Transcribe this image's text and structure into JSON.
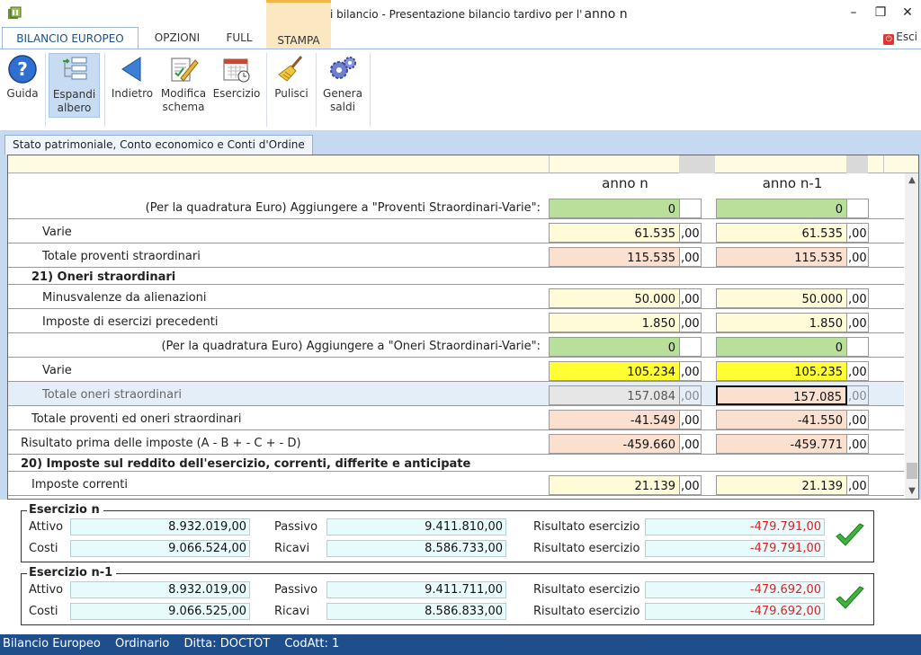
{
  "window": {
    "title": "Saldi di bilancio - Presentazione bilancio tardivo per l'",
    "title_year": "anno n"
  },
  "ribbon_tabs": [
    "BILANCIO EUROPEO",
    "OPZIONI",
    "FULL",
    "STAMPA"
  ],
  "exit_label": "Esci",
  "ribbon_buttons": {
    "guida": [
      "Guida"
    ],
    "espandi": [
      "Espandi",
      "albero"
    ],
    "indietro": [
      "Indietro"
    ],
    "modifica": [
      "Modifica",
      "schema"
    ],
    "esercizio": [
      "Esercizio"
    ],
    "pulisci": [
      "Pulisci"
    ],
    "genera": [
      "Genera",
      "saldi"
    ]
  },
  "sheet_tab": "Stato patrimoniale, Conto economico e Conti d'Ordine",
  "columns": {
    "year_n": "anno n",
    "year_n1": "anno n-1"
  },
  "rows": [
    {
      "label": "(Per la quadratura Euro) Aggiungere a \"Proventi Straordinari-Varie\":",
      "n": "0",
      "n_dec": "",
      "n1": "0",
      "n1_dec": "",
      "style": "green"
    },
    {
      "label": "Varie",
      "n": "61.535",
      "n_dec": ",00",
      "n1": "61.535",
      "n1_dec": ",00",
      "style": "yellow"
    },
    {
      "label": "Totale proventi straordinari",
      "n": "115.535",
      "n_dec": ",00",
      "n1": "115.535",
      "n1_dec": ",00",
      "style": "pink"
    },
    {
      "label": "21) Oneri straordinari",
      "style": "heading"
    },
    {
      "label": "Minusvalenze da alienazioni",
      "n": "50.000",
      "n_dec": ",00",
      "n1": "50.000",
      "n1_dec": ",00",
      "style": "yellow"
    },
    {
      "label": "Imposte di esercizi precedenti",
      "n": "1.850",
      "n_dec": ",00",
      "n1": "1.850",
      "n1_dec": ",00",
      "style": "yellow"
    },
    {
      "label": "(Per la quadratura Euro) Aggiungere a \"Oneri Straordinari-Varie\":",
      "n": "0",
      "n_dec": "",
      "n1": "0",
      "n1_dec": "",
      "style": "green"
    },
    {
      "label": "Varie",
      "n": "105.234",
      "n_dec": ",00",
      "n1": "105.235",
      "n1_dec": ",00",
      "style": "bright"
    },
    {
      "label": "Totale oneri straordinari",
      "n": "157.084",
      "n_dec": ",00",
      "n1": "157.085",
      "n1_dec": ",00",
      "style": "selected"
    },
    {
      "label": "Totale proventi ed oneri straordinari",
      "n": "-41.549",
      "n_dec": ",00",
      "n1": "-41.550",
      "n1_dec": ",00",
      "style": "pink"
    },
    {
      "label": "Risultato prima delle imposte (A - B + - C + - D)",
      "n": "-459.660",
      "n_dec": ",00",
      "n1": "-459.771",
      "n1_dec": ",00",
      "style": "pink"
    },
    {
      "label": "20) Imposte sul reddito dell'esercizio, correnti, differite e anticipate",
      "style": "heading"
    },
    {
      "label": "Imposte correnti",
      "n": "21.139",
      "n_dec": ",00",
      "n1": "21.139",
      "n1_dec": ",00",
      "style": "yellow"
    }
  ],
  "panels": [
    {
      "title": "Esercizio n",
      "attivo_label": "Attivo",
      "attivo": "8.932.019,00",
      "passivo_label": "Passivo",
      "passivo": "9.411.810,00",
      "risultato1_label": "Risultato esercizio",
      "risultato1": "-479.791,00",
      "costi_label": "Costi",
      "costi": "9.066.524,00",
      "ricavi_label": "Ricavi",
      "ricavi": "8.586.733,00",
      "risultato2_label": "Risultato esercizio",
      "risultato2": "-479.791,00"
    },
    {
      "title": "Esercizio n-1",
      "attivo_label": "Attivo",
      "attivo": "8.932.019,00",
      "passivo_label": "Passivo",
      "passivo": "9.411.711,00",
      "risultato1_label": "Risultato esercizio",
      "risultato1": "-479.692,00",
      "costi_label": "Costi",
      "costi": "9.066.525,00",
      "ricavi_label": "Ricavi",
      "ricavi": "8.586.833,00",
      "risultato2_label": "Risultato esercizio",
      "risultato2": "-479.692,00"
    }
  ],
  "status": {
    "schema": "Bilancio Europeo",
    "type": "Ordinario",
    "ditta": "Ditta: DOCTOT",
    "codatt": "CodAtt: 1"
  },
  "colors": {
    "accent": "#1f4e8c",
    "ribbon_tab_active": "#fbe7c2",
    "sheet_band": "#c5d9f1"
  }
}
